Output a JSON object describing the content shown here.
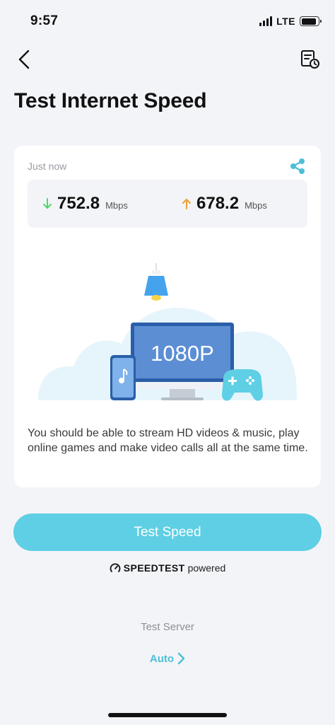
{
  "status_bar": {
    "time": "9:57",
    "network": "LTE",
    "battery_level": 0.9
  },
  "header": {
    "title": "Test Internet Speed"
  },
  "result": {
    "timestamp": "Just now",
    "download": {
      "value": "752.8",
      "unit": "Mbps"
    },
    "upload": {
      "value": "678.2",
      "unit": "Mbps"
    },
    "quality_label": "1080P",
    "description": "You should be able to stream HD videos & music, play online games and make video calls all at the same time."
  },
  "actions": {
    "test_speed_label": "Test Speed"
  },
  "powered_by": {
    "brand": "SPEEDTEST",
    "suffix": "powered"
  },
  "server": {
    "label": "Test Server",
    "value": "Auto"
  },
  "colors": {
    "accent": "#5ecfe4",
    "download_arrow": "#4cd964",
    "upload_arrow": "#f0a030",
    "link": "#4bbfd6"
  },
  "icons": {
    "back": "chevron-left-icon",
    "history": "history-icon",
    "share": "share-icon",
    "download": "arrow-down-icon",
    "upload": "arrow-up-icon",
    "server_chevron": "chevron-right-icon"
  }
}
